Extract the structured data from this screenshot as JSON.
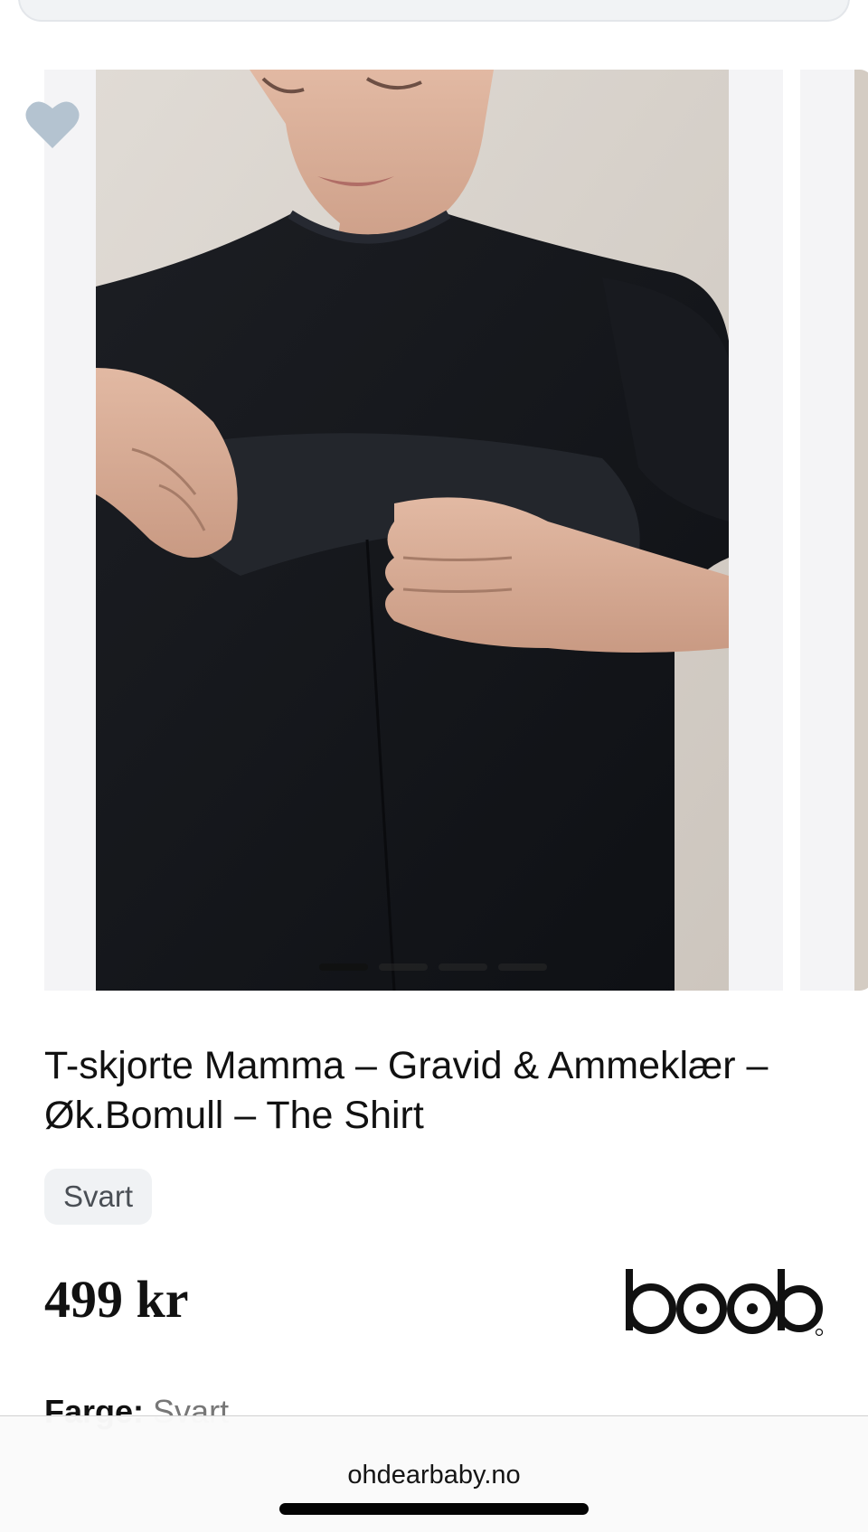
{
  "product": {
    "title": "T-skjorte Mamma – Gravid & Ammeklær – Øk.Bomull – The Shirt",
    "color_chip": "Svart",
    "price": "499 kr",
    "brand": "boob",
    "color_label": "Farge:",
    "color_value": "Svart"
  },
  "carousel": {
    "slide_count": 4,
    "active_index": 0,
    "photo_description_icon": "product-photo"
  },
  "favorite": {
    "icon": "heart-icon",
    "color": "#b4c3d0"
  },
  "browser": {
    "url": "ohdearbaby.no"
  },
  "colors": {
    "text": "#111111",
    "chip_bg": "#f0f2f4",
    "shirt": "#15171b"
  }
}
